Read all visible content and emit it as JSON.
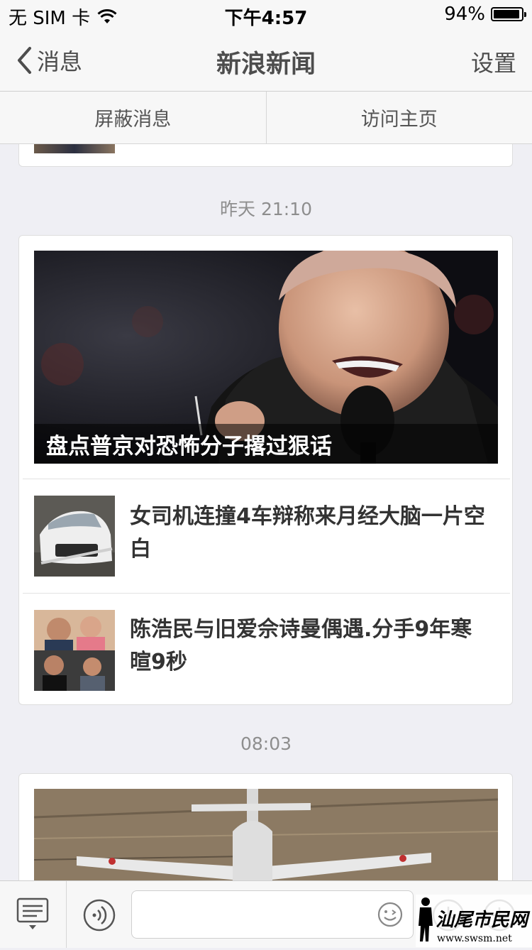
{
  "status_bar": {
    "carrier": "无 SIM 卡",
    "time": "下午4:57",
    "battery": "94%",
    "battery_level": 0.94
  },
  "nav": {
    "back_label": "消息",
    "title": "新浪新闻",
    "settings_label": "设置"
  },
  "actions": {
    "block_label": "屏蔽消息",
    "visit_label": "访问主页"
  },
  "messages": [
    {
      "timestamp": "昨天 21:10",
      "hero_caption": "盘点普京对恐怖分子撂过狠话",
      "items": [
        {
          "title": "女司机连撞4车辩称来月经大脑一片空白"
        },
        {
          "title": "陈浩民与旧爱佘诗曼偶遇.分手9年寒暄9秒"
        }
      ]
    },
    {
      "timestamp": "08:03"
    }
  ],
  "watermark": {
    "text": "汕尾市民网",
    "url": "www.swsm.net"
  },
  "colors": {
    "background": "#efeff4",
    "bar": "#f7f7f7",
    "icon": "#555555"
  },
  "icons": [
    "wifi-icon",
    "battery-icon",
    "back-chevron-icon",
    "menu-keyboard-icon",
    "voice-icon",
    "emoji-icon",
    "clock-icon",
    "plus-icon"
  ]
}
